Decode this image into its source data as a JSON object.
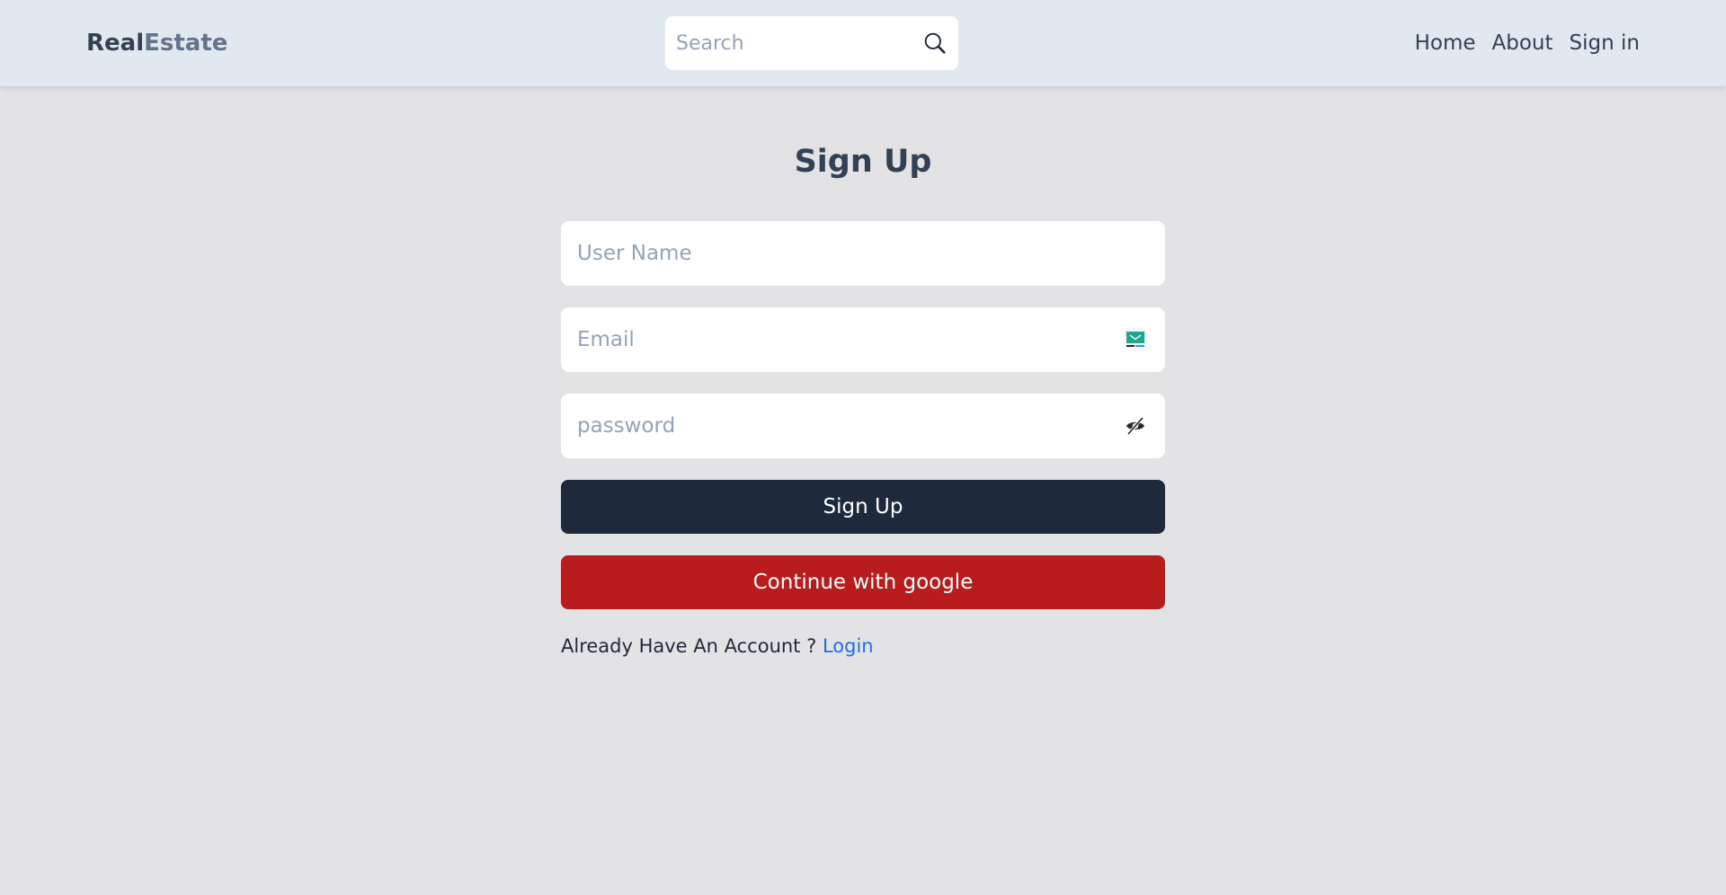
{
  "header": {
    "logo": {
      "part1": "Real",
      "part2": "Estate"
    },
    "search": {
      "placeholder": "Search",
      "value": "",
      "icon": "search-icon"
    },
    "nav": [
      {
        "label": "Home"
      },
      {
        "label": "About"
      },
      {
        "label": "Sign in"
      }
    ]
  },
  "main": {
    "title": "Sign Up",
    "fields": {
      "username": {
        "placeholder": "User Name",
        "value": ""
      },
      "email": {
        "placeholder": "Email",
        "value": "",
        "icon": "tempmail-icon"
      },
      "password": {
        "placeholder": "password",
        "value": "",
        "icon": "eye-slash-icon"
      }
    },
    "buttons": {
      "signup": "Sign Up",
      "google": "Continue with google"
    },
    "footer": {
      "text": "Already Have An Account ?",
      "link": "Login"
    }
  },
  "colors": {
    "header_bg": "#e2e8f0",
    "page_bg": "#e3e3e6",
    "primary_button": "#1e293b",
    "google_button": "#b91c1c",
    "link": "#1d6ef0",
    "tempmail_green": "#1fa88e"
  }
}
